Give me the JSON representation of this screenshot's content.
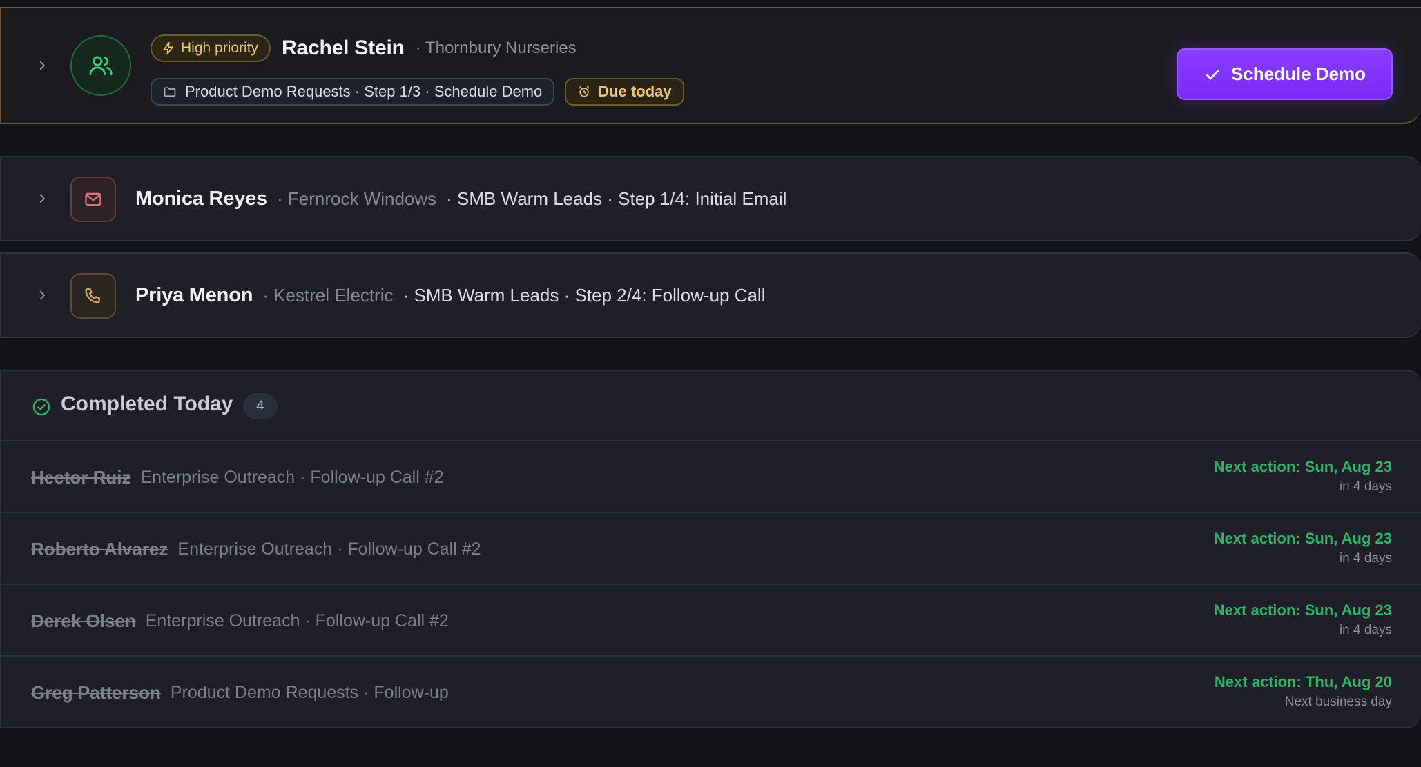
{
  "active_task": {
    "priority_label": "High priority",
    "name": "Rachel Stein",
    "company": "· Thornbury Nurseries",
    "sequence": "Product Demo Requests · Step 1/3 · Schedule Demo",
    "due": "Due today",
    "action_label": "Schedule Demo",
    "avatar_icon": "users-icon",
    "accent_color": "#7a2cf5"
  },
  "tasks": [
    {
      "icon": "mail-icon",
      "name": "Monica Reyes",
      "company": "· Fernrock Windows",
      "sequence": "· SMB Warm Leads · Step 1/4: Initial Email"
    },
    {
      "icon": "phone-icon",
      "name": "Priya Menon",
      "company": "· Kestrel Electric",
      "sequence": "· SMB Warm Leads · Step 2/4: Follow-up Call"
    }
  ],
  "completed": {
    "title": "Completed Today",
    "count": "4",
    "items": [
      {
        "name": "Hector Ruiz",
        "sequence": "Enterprise Outreach · Follow-up Call #2",
        "next_action": "Next action: Sun, Aug 23",
        "relative": "in 4 days"
      },
      {
        "name": "Roberto Alvarez",
        "sequence": "Enterprise Outreach · Follow-up Call #2",
        "next_action": "Next action: Sun, Aug 23",
        "relative": "in 4 days"
      },
      {
        "name": "Derek Olsen",
        "sequence": "Enterprise Outreach · Follow-up Call #2",
        "next_action": "Next action: Sun, Aug 23",
        "relative": "in 4 days"
      },
      {
        "name": "Greg Patterson",
        "sequence": "Product Demo Requests · Follow-up",
        "next_action": "Next action: Thu, Aug 20",
        "relative": "Next business day"
      }
    ]
  },
  "colors": {
    "success": "#2fb46a",
    "warning": "#e8c67a",
    "background": "#121317"
  }
}
